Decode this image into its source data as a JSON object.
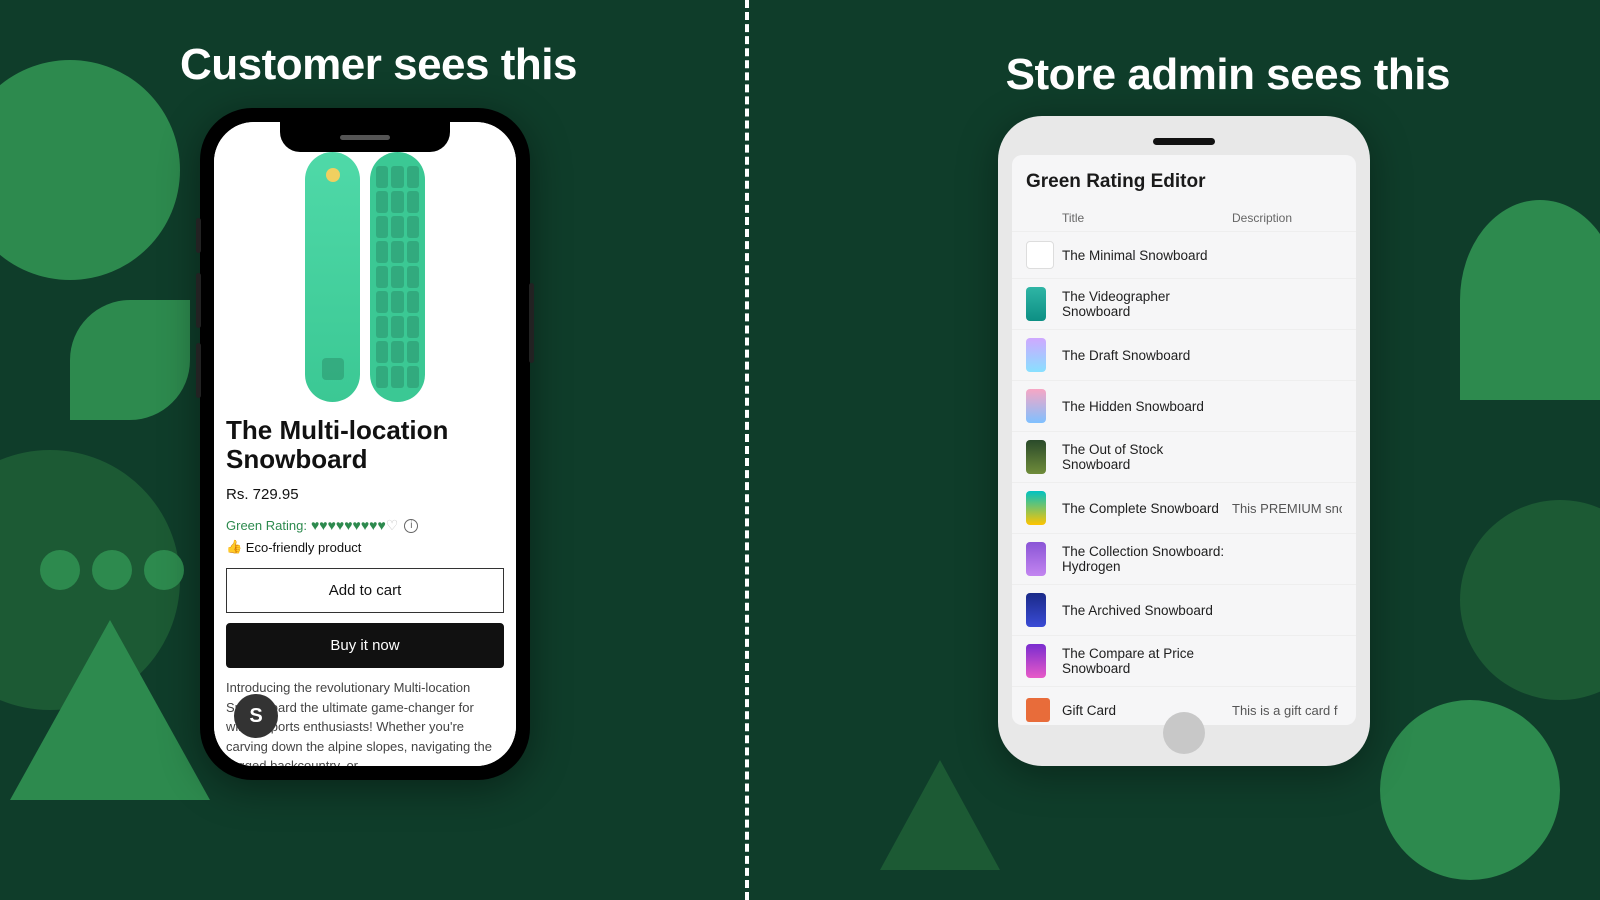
{
  "headings": {
    "left": "Customer sees this",
    "right": "Store admin sees this"
  },
  "customer": {
    "product_title": "The Multi-location Snowboard",
    "price": "Rs. 729.95",
    "rating_label": "Green Rating:",
    "rating_filled": 9,
    "rating_empty": 1,
    "info_glyph": "i",
    "eco_thumb": "👍",
    "eco_text": " Eco-friendly product",
    "add_to_cart": "Add to cart",
    "buy_now": "Buy it now",
    "description": "Introducing the revolutionary Multi-location Snow Board the ultimate game-changer for winter sports enthusiasts! Whether you're carving down the alpine slopes, navigating the rugged backcountry, or",
    "shop_badge": "S"
  },
  "admin": {
    "header": "Green Rating Editor",
    "columns": {
      "title": "Title",
      "description": "Description"
    },
    "rows": [
      {
        "title": "The Minimal Snowboard",
        "desc": "",
        "thumb": "empty"
      },
      {
        "title": "The Videographer Snowboard",
        "desc": "",
        "thumb": "g:#2fb5a5,#0d8f84"
      },
      {
        "title": "The Draft Snowboard",
        "desc": "",
        "thumb": "g:#cfa8ff,#88e0ff"
      },
      {
        "title": "The Hidden Snowboard",
        "desc": "",
        "thumb": "g:#f7a6c4,#7fc0ff"
      },
      {
        "title": "The Out of Stock Snowboard",
        "desc": "",
        "thumb": "g:#2a4a2a,#6f8c3a"
      },
      {
        "title": "The Complete Snowboard",
        "desc": "This PREMIUM sno",
        "thumb": "g:#00c2c2,#ffc400"
      },
      {
        "title": "The Collection Snowboard: Hydrogen",
        "desc": "",
        "thumb": "g:#8a55d6,#c385f0"
      },
      {
        "title": "The Archived Snowboard",
        "desc": "",
        "thumb": "g:#1a2a88,#3a4bd6"
      },
      {
        "title": "The Compare at Price Snowboard",
        "desc": "",
        "thumb": "g:#7a2ccf,#e85ac8"
      },
      {
        "title": "Gift Card",
        "desc": "This is a gift card f",
        "thumb": "gift"
      }
    ]
  }
}
